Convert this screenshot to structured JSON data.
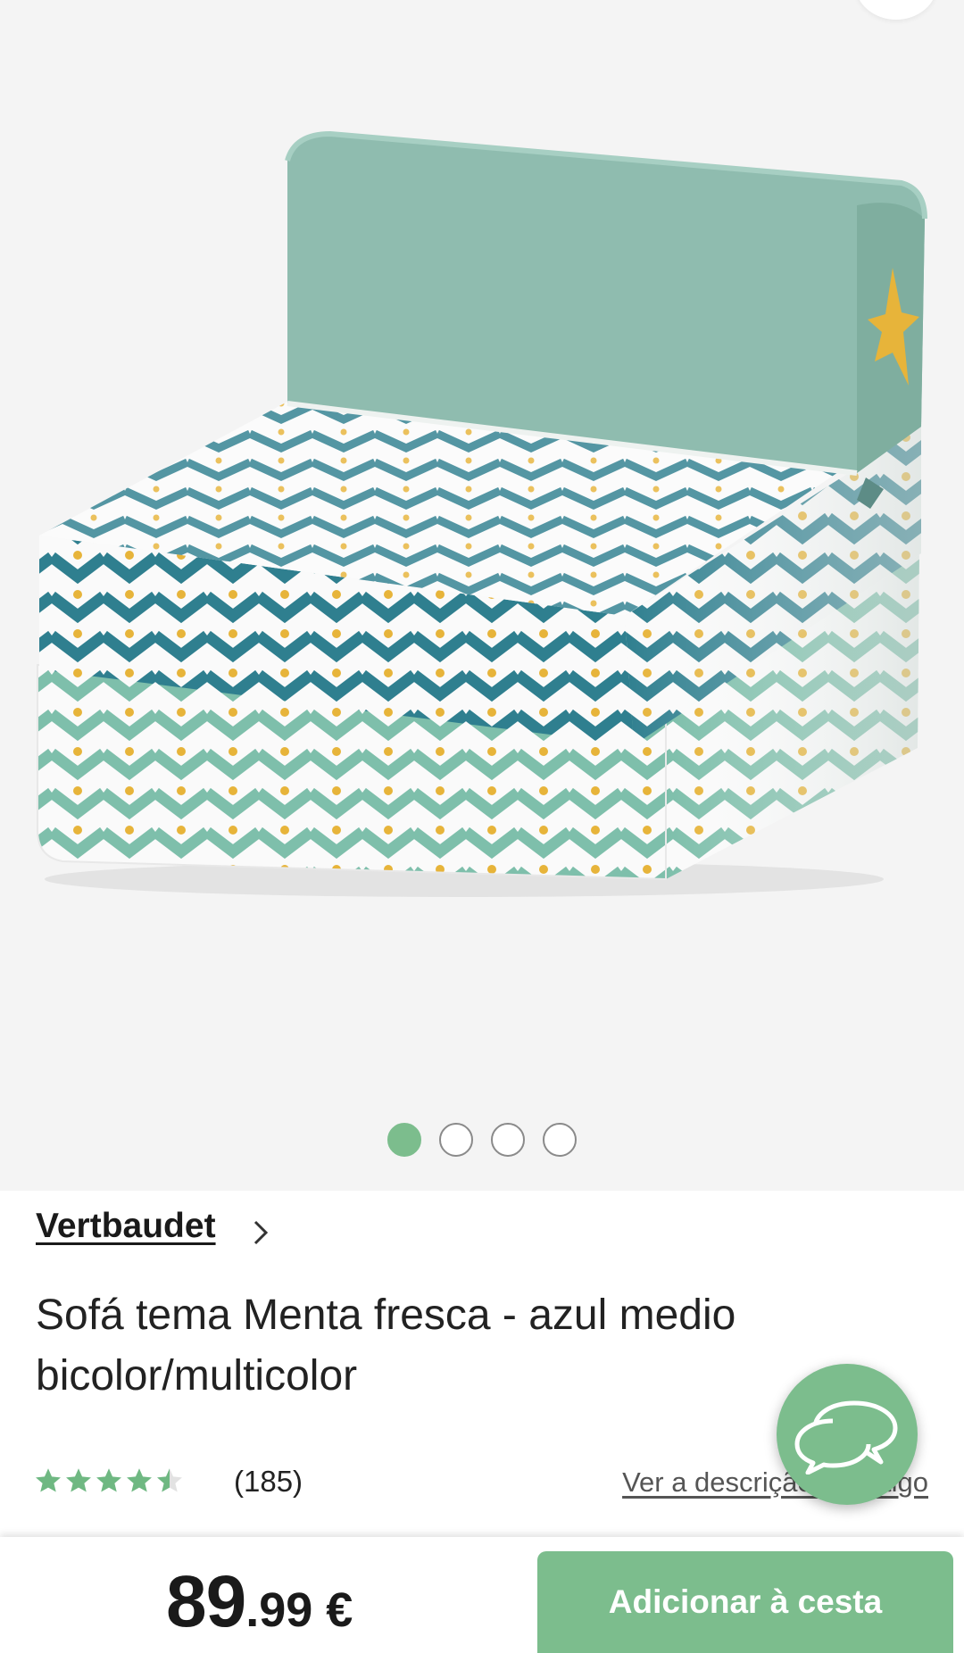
{
  "gallery": {
    "image_alt": "Sofá tema Menta fresca",
    "slide_count": 4,
    "active_slide": 1
  },
  "product": {
    "brand": "Vertbaudet",
    "title": "Sofá tema Menta fresca - azul medio bicolor/multicolor",
    "rating_value": 4.5,
    "rating_max": 5,
    "review_count": "(185)",
    "description_link": "Ver a descrição do artigo"
  },
  "purchase": {
    "price_integer": "89",
    "price_rest": ".99 €",
    "add_to_cart_label": "Adicionar à cesta"
  },
  "colors": {
    "accent": "#7cbd8d",
    "star_filled": "#6fb882",
    "star_empty": "#e2e2e2",
    "sofa_mint": "#8fbcaf",
    "pattern_teal": "#2f7f8f",
    "pattern_mint": "#7ebfab",
    "pattern_dot": "#e7b43a"
  },
  "icons": {
    "brand_chevron": "chevron-right-icon",
    "chat": "chat-bubbles-icon",
    "star": "star-icon"
  }
}
